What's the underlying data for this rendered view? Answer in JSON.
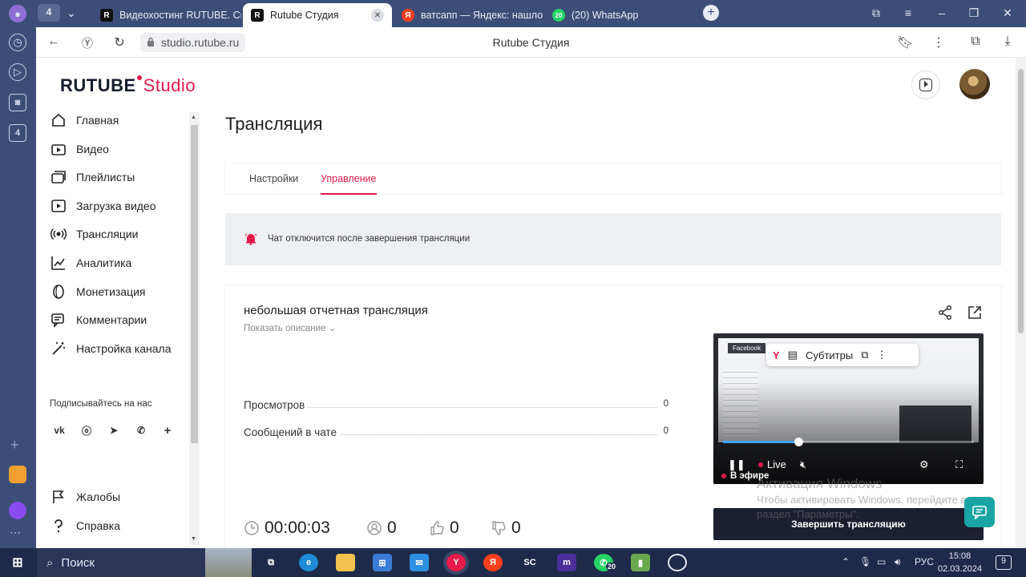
{
  "browser": {
    "rail_badge": "4",
    "tabs": [
      {
        "label": "Видеохостинг RUTUBE. Смотр",
        "favicon": "R"
      },
      {
        "label": "Rutube Студия",
        "favicon": "R"
      },
      {
        "label": "ватсапп — Яндекс: нашлось",
        "favicon": "Я"
      },
      {
        "label": "(20) WhatsApp",
        "favicon": "20"
      }
    ],
    "tab_counter": "4",
    "url": "studio.rutube.ru",
    "page_title": "Rutube Студия"
  },
  "logo": {
    "word1": "RUTUBE",
    "word2": "Studio"
  },
  "sidebar": {
    "items": [
      {
        "label": "Главная",
        "icon": "home-icon"
      },
      {
        "label": "Видео",
        "icon": "video-icon"
      },
      {
        "label": "Плейлисты",
        "icon": "playlist-icon"
      },
      {
        "label": "Загрузка видео",
        "icon": "upload-icon"
      },
      {
        "label": "Трансляции",
        "icon": "broadcast-icon"
      },
      {
        "label": "Аналитика",
        "icon": "analytics-icon"
      },
      {
        "label": "Монетизация",
        "icon": "coin-icon"
      },
      {
        "label": "Комментарии",
        "icon": "comments-icon"
      },
      {
        "label": "Настройка канала",
        "icon": "wand-icon"
      }
    ],
    "follow_label": "Подписывайтесь на нас",
    "socials": [
      "vk",
      "ok",
      "telegram",
      "viber",
      "more"
    ],
    "bottom_items": [
      {
        "label": "Жалобы",
        "icon": "flag-icon"
      },
      {
        "label": "Справка",
        "icon": "help-icon"
      }
    ]
  },
  "main": {
    "heading": "Трансляция",
    "tabs": [
      {
        "label": "Настройки"
      },
      {
        "label": "Управление"
      }
    ],
    "alert": "Чат отключится после завершения трансляции",
    "stream": {
      "title": "небольшая отчетная трансляция",
      "show_description": "Показать описание",
      "stats": [
        {
          "label": "Просмотров",
          "value": "0"
        },
        {
          "label": "Сообщений в чате",
          "value": "0"
        }
      ],
      "duration": "00:00:03",
      "viewers": "0",
      "likes": "0",
      "dislikes": "0"
    },
    "player": {
      "toolbar_brand": "Y",
      "subtitles": "Субтитры",
      "tag": "Facebook",
      "live": "Live",
      "on_air": "В эфире",
      "progress": 0.3
    },
    "end_button": "Завершить трансляцию"
  },
  "watermark": {
    "line1": "Активация Windows",
    "line2": "Чтобы активировать Windows, перейдите в",
    "line3": "раздел \"Параметры\"."
  },
  "taskbar": {
    "search_label": "Поиск",
    "whatsapp_badge": "20",
    "lang": "РУС",
    "time": "15:08",
    "date": "02.03.2024",
    "notifications": "9"
  }
}
